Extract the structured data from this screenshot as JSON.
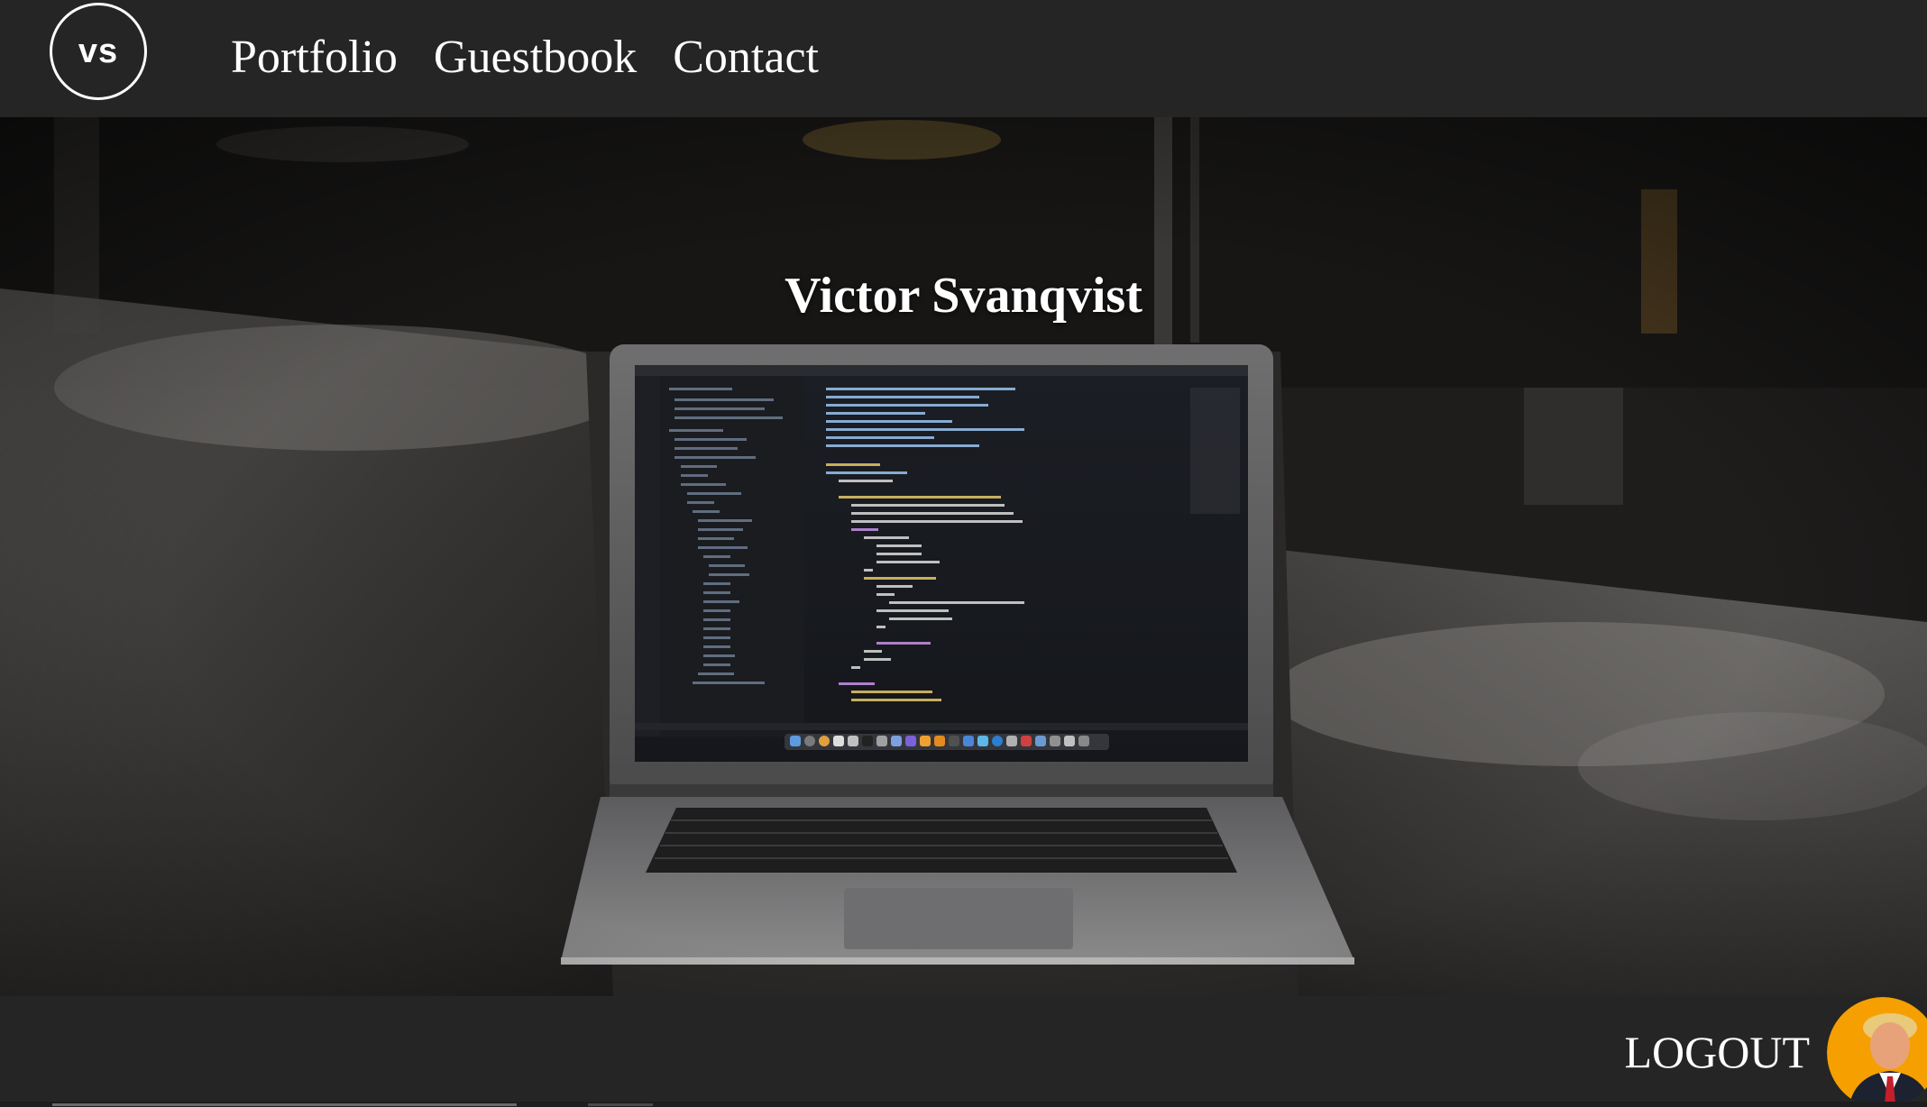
{
  "header": {
    "logo_text": "vs",
    "nav": [
      {
        "label": "Portfolio"
      },
      {
        "label": "Guestbook"
      },
      {
        "label": "Contact"
      }
    ]
  },
  "hero": {
    "title": "Victor Svanqvist"
  },
  "footer": {
    "logout_label": "LOGOUT"
  },
  "icons": {
    "logo": "vs-logo-icon",
    "avatar": "user-avatar"
  },
  "colors": {
    "header_bg": "#252525",
    "footer_bg": "#252525",
    "avatar_bg": "#f5a000",
    "text": "#ffffff"
  }
}
